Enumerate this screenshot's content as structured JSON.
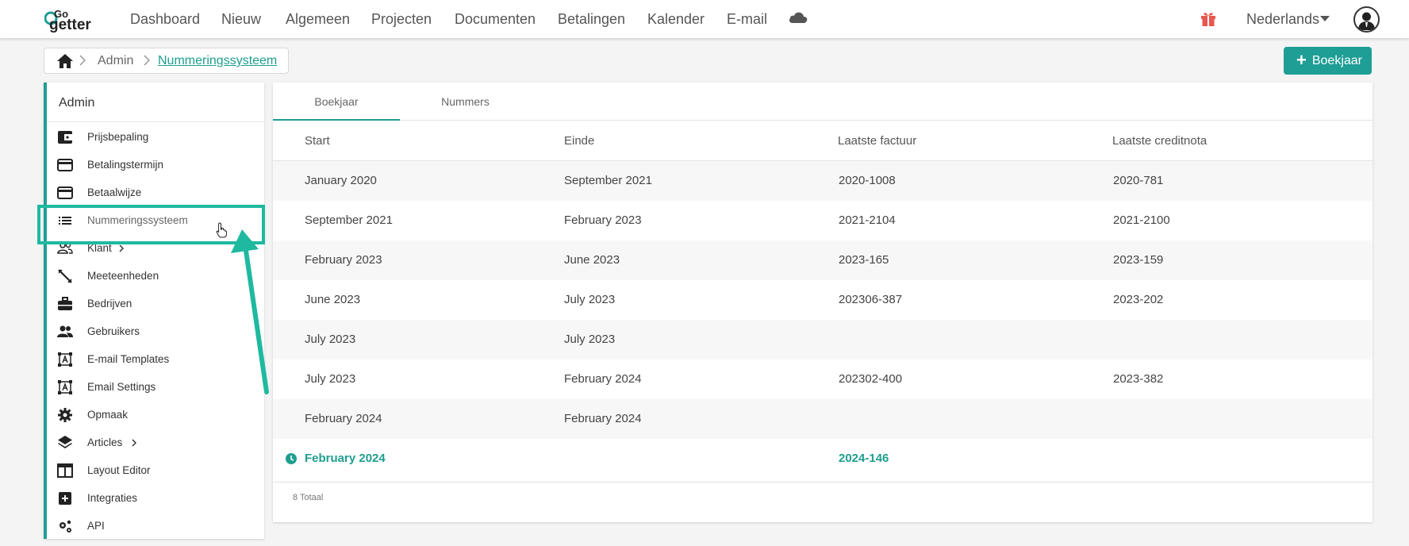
{
  "nav": {
    "logo_top": "Go",
    "logo_bottom": "getter",
    "items": [
      "Dashboard",
      "Nieuw",
      "Algemeen",
      "Projecten",
      "Documenten",
      "Betalingen",
      "Kalender",
      "E-mail"
    ],
    "language": "Nederlands"
  },
  "breadcrumb": {
    "level1": "Admin",
    "current": "Nummeringssysteem"
  },
  "add_button": {
    "label": "Boekjaar"
  },
  "sidebar": {
    "title": "Admin",
    "items": [
      {
        "label": "Prijsbepaling",
        "icon": "wallet-icon"
      },
      {
        "label": "Betalingstermijn",
        "icon": "credit-card-icon"
      },
      {
        "label": "Betaalwijze",
        "icon": "credit-card-icon"
      },
      {
        "label": "Nummeringssysteem",
        "icon": "list-icon"
      },
      {
        "label": "Klant",
        "icon": "users-outline-icon"
      },
      {
        "label": "Meeteenheden",
        "icon": "ruler-icon"
      },
      {
        "label": "Bedrijven",
        "icon": "briefcase-icon"
      },
      {
        "label": "Gebruikers",
        "icon": "users-icon"
      },
      {
        "label": "E-mail Templates",
        "icon": "text-box-icon"
      },
      {
        "label": "Email Settings",
        "icon": "text-box-icon"
      },
      {
        "label": "Opmaak",
        "icon": "gear-icon"
      },
      {
        "label": "Articles",
        "icon": "layers-icon"
      },
      {
        "label": "Layout Editor",
        "icon": "layout-icon"
      },
      {
        "label": "Integraties",
        "icon": "plus-box-icon"
      },
      {
        "label": "API",
        "icon": "gears-icon"
      }
    ]
  },
  "tabs": [
    "Boekjaar",
    "Nummers"
  ],
  "table": {
    "headers": [
      "Start",
      "Einde",
      "Laatste factuur",
      "Laatste creditnota"
    ],
    "rows": [
      [
        "January 2020",
        "September 2021",
        "2020-1008",
        "2020-781"
      ],
      [
        "September 2021",
        "February 2023",
        "2021-2104",
        "2021-2100"
      ],
      [
        "February 2023",
        "June 2023",
        "2023-165",
        "2023-159"
      ],
      [
        "June 2023",
        "July 2023",
        "202306-387",
        "2023-202"
      ],
      [
        "July 2023",
        "July 2023",
        "",
        ""
      ],
      [
        "July 2023",
        "February 2024",
        "202302-400",
        "2023-382"
      ],
      [
        "February 2024",
        "February 2024",
        "",
        ""
      ],
      [
        "February 2024",
        "",
        "2024-146",
        ""
      ]
    ],
    "total": "8 Totaal"
  },
  "colors": {
    "accent": "#1f9e95",
    "highlight": "#1fb9a0",
    "gift": "#e8574e"
  }
}
